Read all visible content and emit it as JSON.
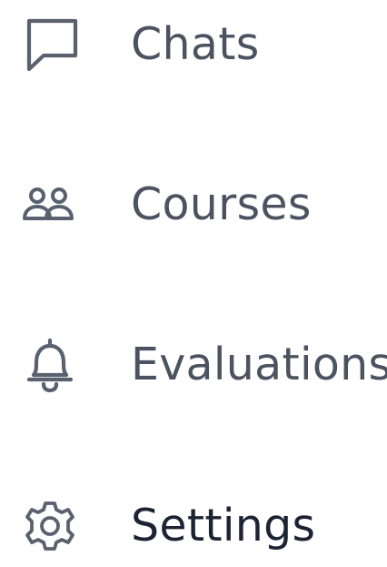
{
  "nav": {
    "items": [
      {
        "label": "Chats",
        "icon": "chat-bubble-icon",
        "active": false
      },
      {
        "label": "Courses",
        "icon": "users-group-icon",
        "active": false
      },
      {
        "label": "Evaluations",
        "icon": "bell-icon",
        "active": false
      },
      {
        "label": "Settings",
        "icon": "gear-icon",
        "active": true
      }
    ]
  },
  "colors": {
    "icon": "#5a616e",
    "text": "#4b5260",
    "active_text": "#1c2433",
    "background": "#ffffff"
  }
}
